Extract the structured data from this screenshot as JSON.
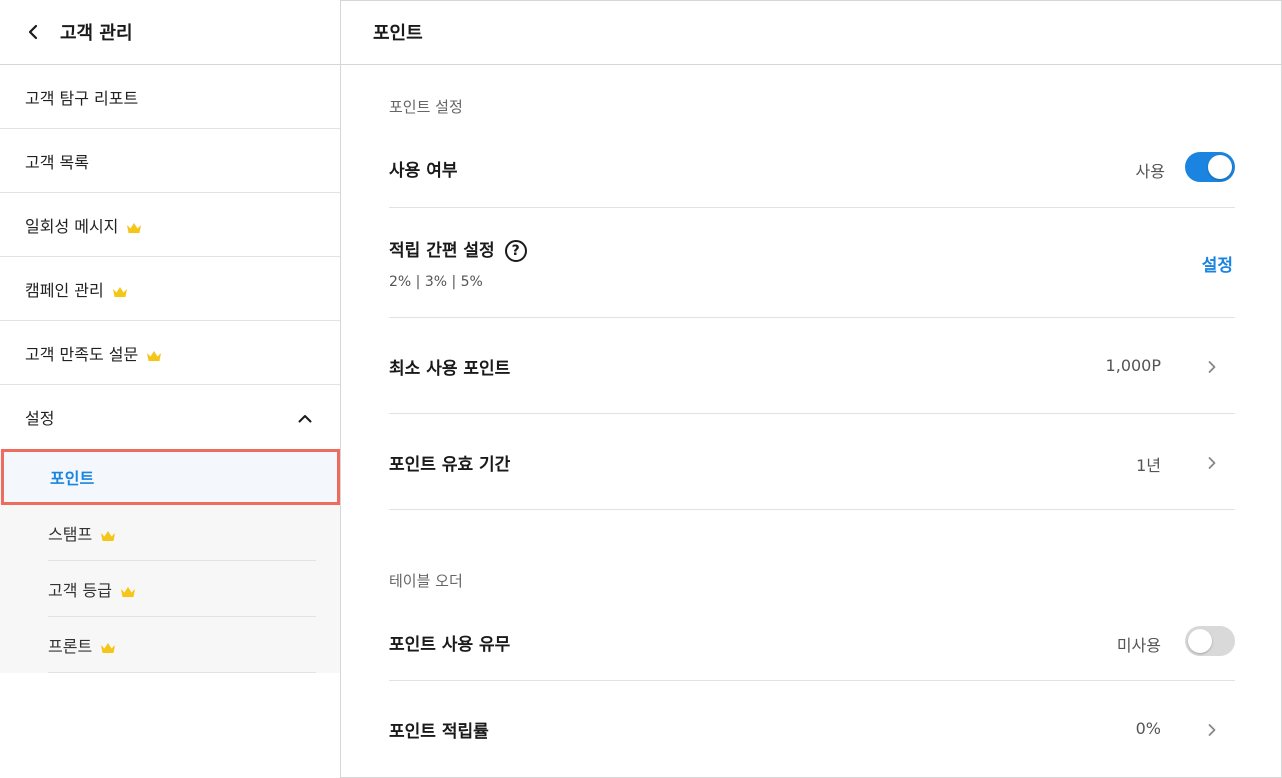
{
  "sidebar": {
    "title": "고객 관리",
    "items": [
      {
        "label": "고객 탐구 리포트",
        "premium": false
      },
      {
        "label": "고객 목록",
        "premium": false
      },
      {
        "label": "일회성 메시지",
        "premium": true
      },
      {
        "label": "캠페인 관리",
        "premium": true
      },
      {
        "label": "고객 만족도 설문",
        "premium": true
      }
    ],
    "settings_label": "설정",
    "sub_items": [
      {
        "label": "포인트",
        "active": true,
        "premium": false
      },
      {
        "label": "스탬프",
        "active": false,
        "premium": true
      },
      {
        "label": "고객 등급",
        "active": false,
        "premium": true
      },
      {
        "label": "프론트",
        "active": false,
        "premium": true
      }
    ]
  },
  "main": {
    "title": "포인트",
    "point_settings": {
      "section_title": "포인트 설정",
      "usage": {
        "label": "사용 여부",
        "value": "사용",
        "enabled": true
      },
      "quick_setup": {
        "label": "적립 간편 설정",
        "help_icon": "question-circle-icon",
        "rates": "2%  |  3%  |  5%",
        "action": "설정"
      },
      "min_points": {
        "label": "최소 사용 포인트",
        "value": "1,000P"
      },
      "validity": {
        "label": "포인트 유효 기간",
        "value": "1년"
      }
    },
    "table_order": {
      "section_title": "테이블 오더",
      "usage": {
        "label": "포인트 사용 유무",
        "value": "미사용",
        "enabled": false
      },
      "rate": {
        "label": "포인트 적립률",
        "value": "0%"
      }
    }
  },
  "colors": {
    "accent": "#1a84e0",
    "highlight_border": "#ee6c5d",
    "crown": "#f5c518",
    "toggle_off": "#d9d9d9"
  }
}
